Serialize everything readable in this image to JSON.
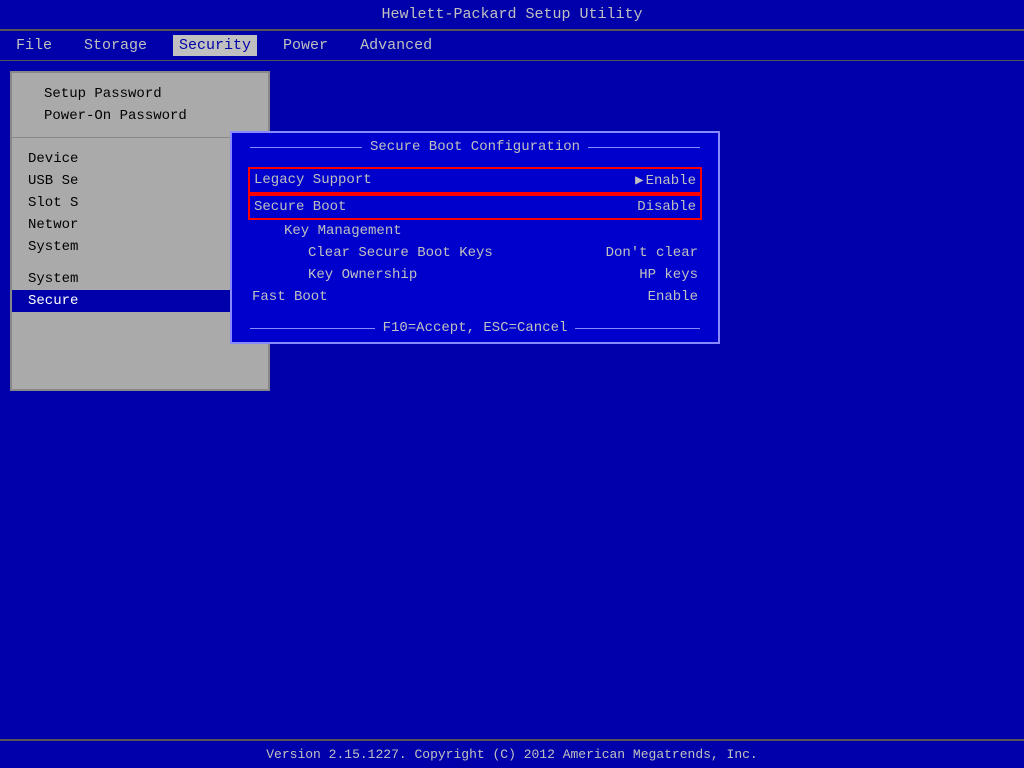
{
  "title_bar": {
    "text": "Hewlett-Packard Setup Utility"
  },
  "menu": {
    "items": [
      {
        "label": "File",
        "active": false
      },
      {
        "label": "Storage",
        "active": false
      },
      {
        "label": "Security",
        "active": true
      },
      {
        "label": "Power",
        "active": false
      },
      {
        "label": "Advanced",
        "active": false
      }
    ]
  },
  "left_panel": {
    "items_top": [
      {
        "label": "Setup Password",
        "highlighted": false
      },
      {
        "label": "Power-On Password",
        "highlighted": false
      }
    ],
    "items_middle": [
      {
        "label": "Device",
        "highlighted": false,
        "truncated": "Device"
      },
      {
        "label": "USB Se",
        "highlighted": false
      },
      {
        "label": "Slot S",
        "highlighted": false
      },
      {
        "label": "Networ",
        "highlighted": false
      },
      {
        "label": "System",
        "highlighted": false
      }
    ],
    "items_bottom": [
      {
        "label": "System",
        "highlighted": false
      },
      {
        "label": "Secure",
        "highlighted": true
      }
    ]
  },
  "dialog": {
    "title": "Secure Boot Configuration",
    "rows": [
      {
        "label": "Legacy Support",
        "value": "Enable",
        "has_arrow": true,
        "selected": true,
        "indent": 0
      },
      {
        "label": "Secure Boot",
        "value": "Disable",
        "has_arrow": false,
        "selected": true,
        "indent": 0
      },
      {
        "label": "Key Management",
        "value": "",
        "has_arrow": false,
        "selected": false,
        "indent": 1
      },
      {
        "label": "Clear Secure Boot Keys",
        "value": "Don't clear",
        "has_arrow": false,
        "selected": false,
        "indent": 2
      },
      {
        "label": "Key Ownership",
        "value": "HP keys",
        "has_arrow": false,
        "selected": false,
        "indent": 2
      },
      {
        "label": "Fast Boot",
        "value": "Enable",
        "has_arrow": false,
        "selected": false,
        "indent": 0
      }
    ],
    "footer": "F10=Accept, ESC=Cancel"
  },
  "status_bar": {
    "text": "Version 2.15.1227. Copyright (C) 2012 American Megatrends, Inc."
  }
}
